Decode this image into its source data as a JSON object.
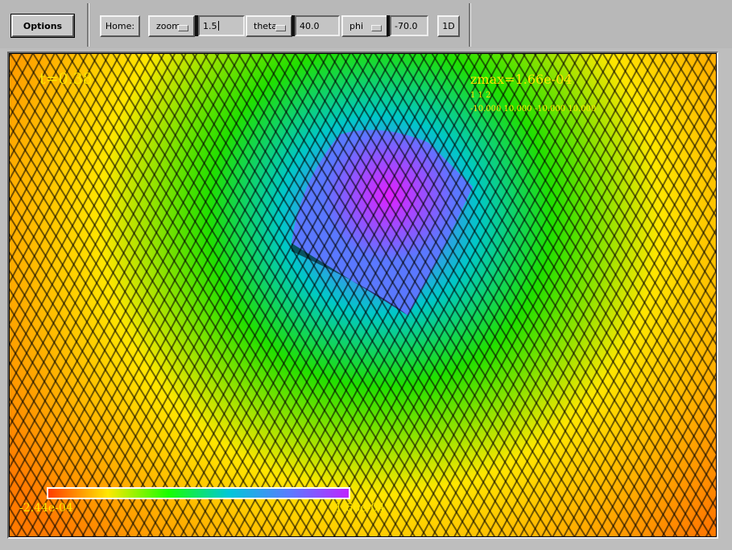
{
  "toolbar": {
    "options_label": "Options",
    "home_label": "Home:",
    "zoom": {
      "label": "zoom",
      "value": "1.5"
    },
    "theta": {
      "label": "theta",
      "value": "40.0"
    },
    "phi": {
      "label": "phi",
      "value": "-70.0"
    },
    "dim_label": "1D"
  },
  "plot": {
    "time_label": "t=0.38",
    "range_label": "zmax=1.66e-04",
    "sub_label": "1 1 2",
    "bounds_label": "-10.000 10.000 -10.000 10.000",
    "colorbar": {
      "min_label": "-2.44e-04",
      "max_label": "1.66e-04",
      "colors": [
        "#ff3a00",
        "#ffe800",
        "#18ff00",
        "#00c8d8",
        "#5a7cff",
        "#bf24ff"
      ]
    },
    "surface_colors": {
      "outer": "#ff7a00",
      "mid": "#ffe600",
      "green": "#20e000",
      "cyan": "#00c8c8",
      "blue": "#5a78ff",
      "peak": "#e020ff"
    }
  }
}
